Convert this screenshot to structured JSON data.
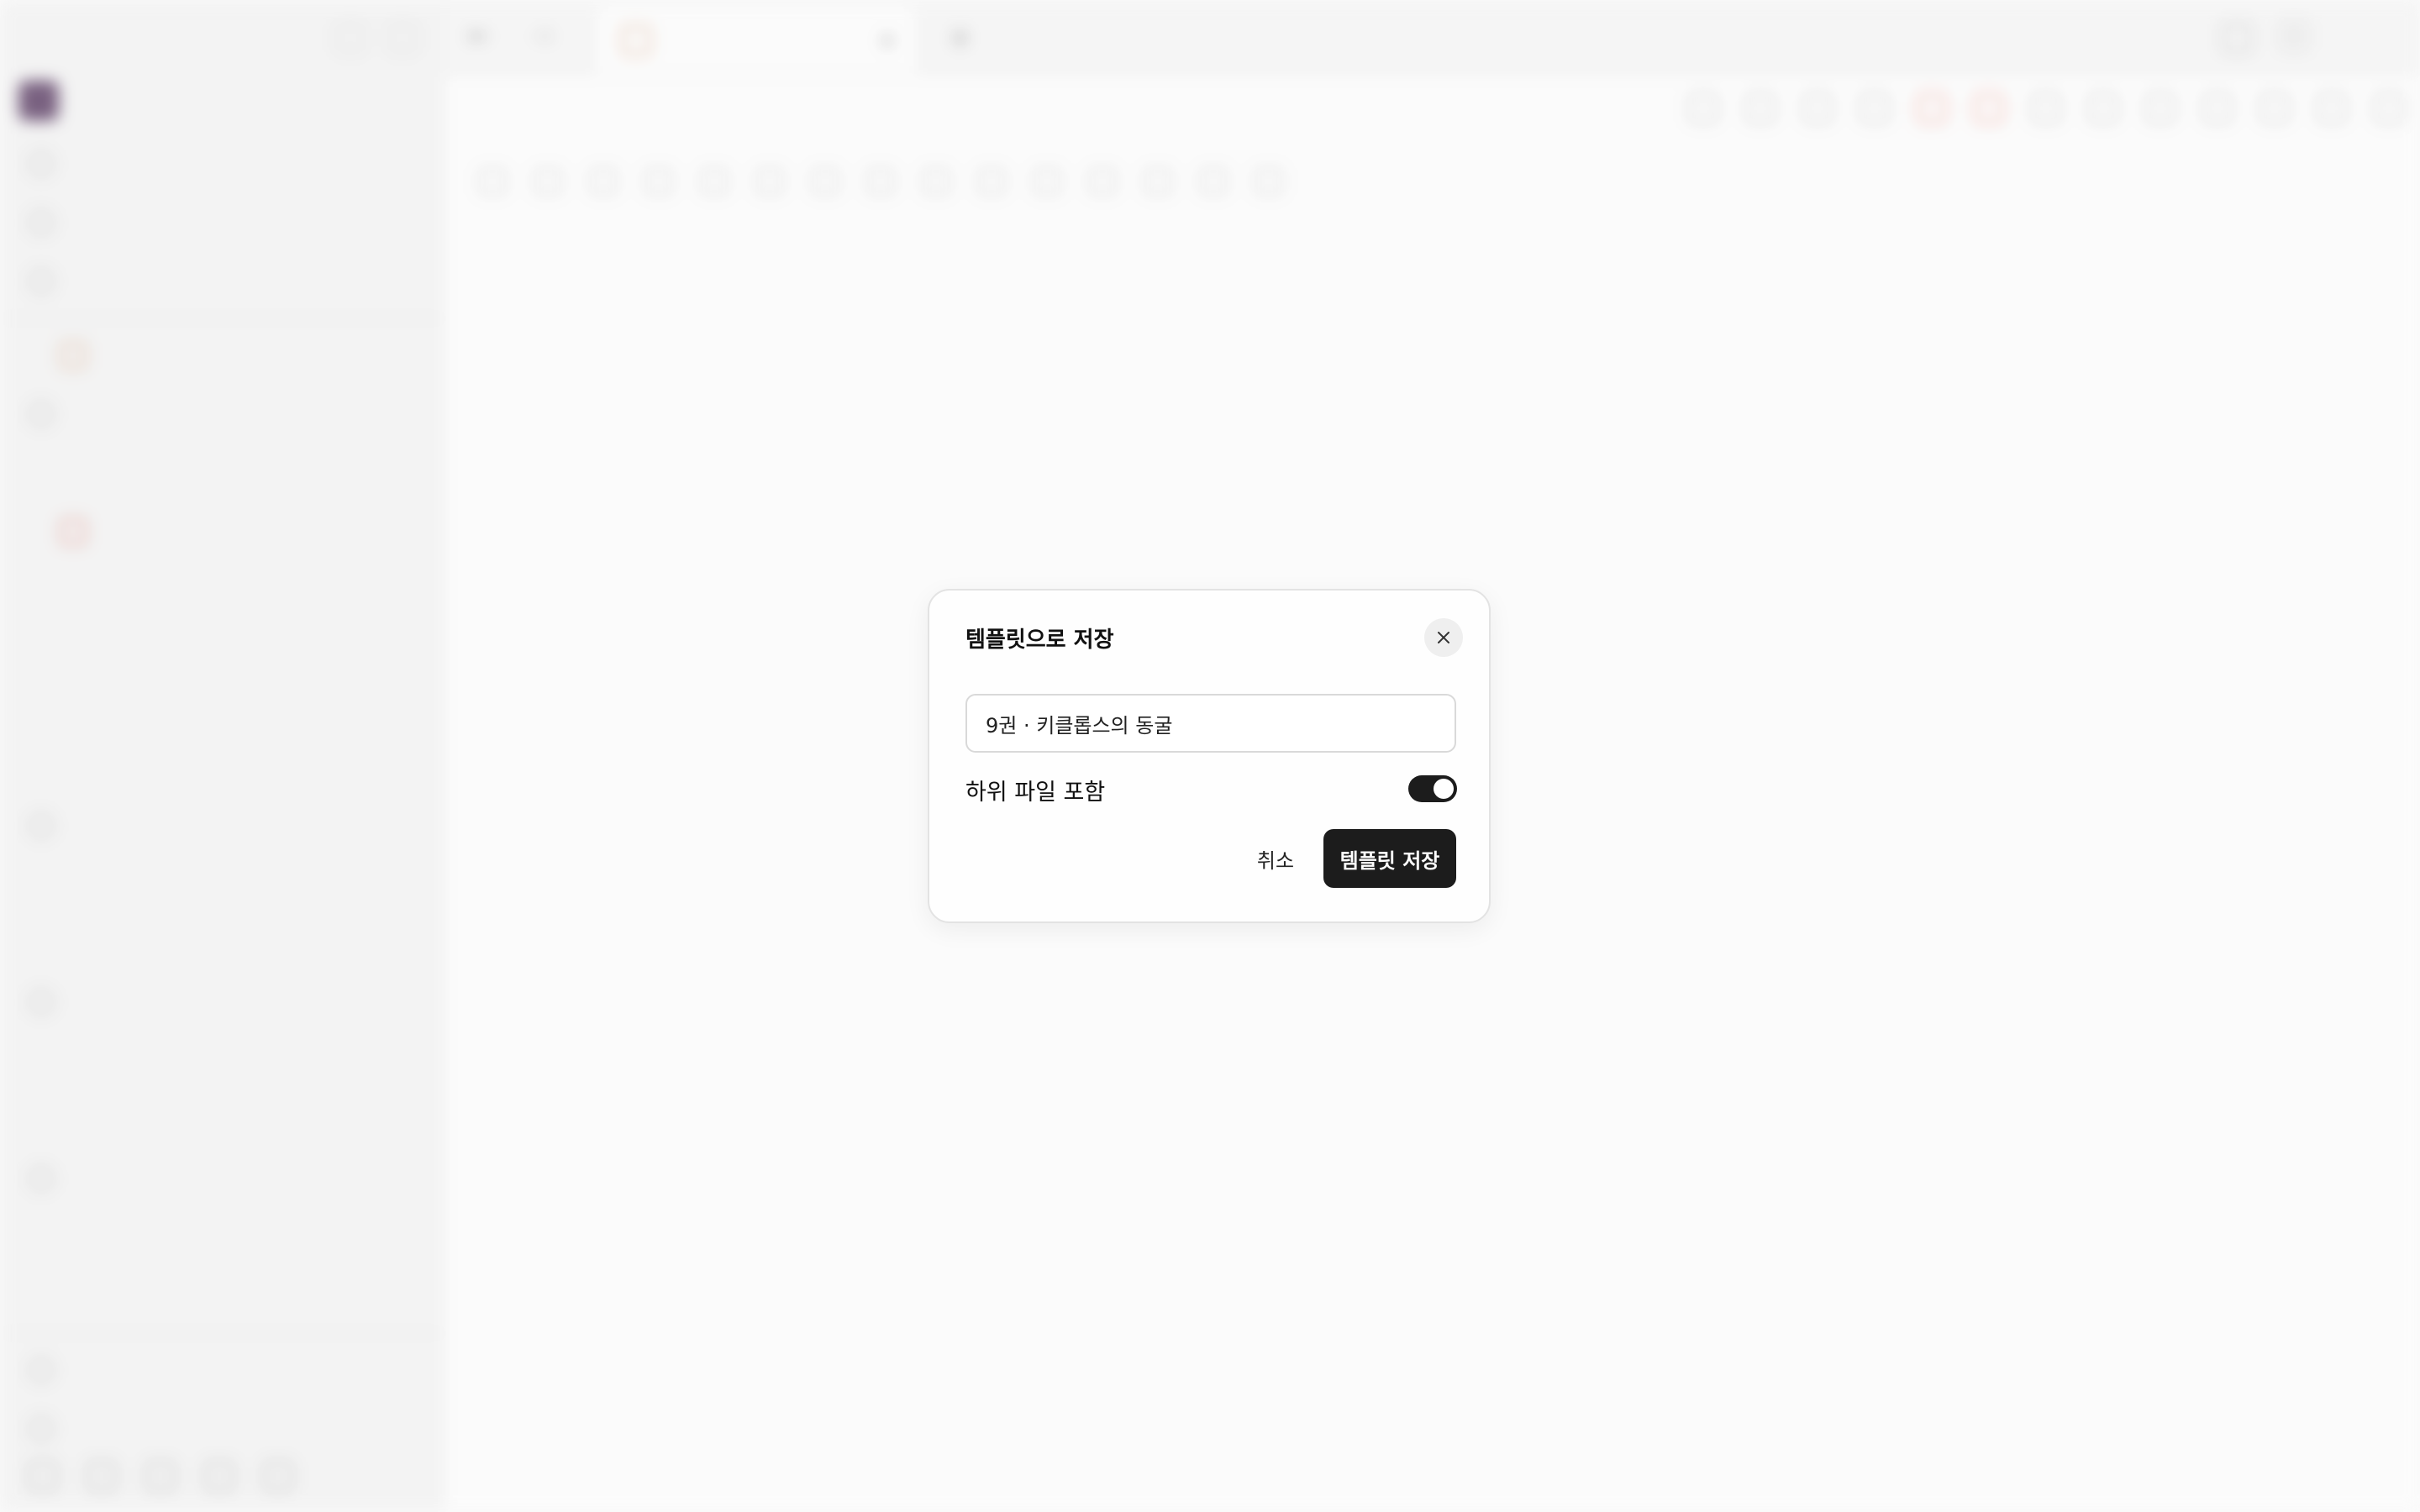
{
  "dialog": {
    "title": "템플릿으로 저장",
    "name_value": "9권 · 키클롭스의 동굴",
    "include_subfiles_label": "하위 파일 포함",
    "include_subfiles_on": true,
    "cancel_label": "취소",
    "save_label": "템플릿 저장"
  },
  "icons": {
    "close": "close-icon"
  }
}
